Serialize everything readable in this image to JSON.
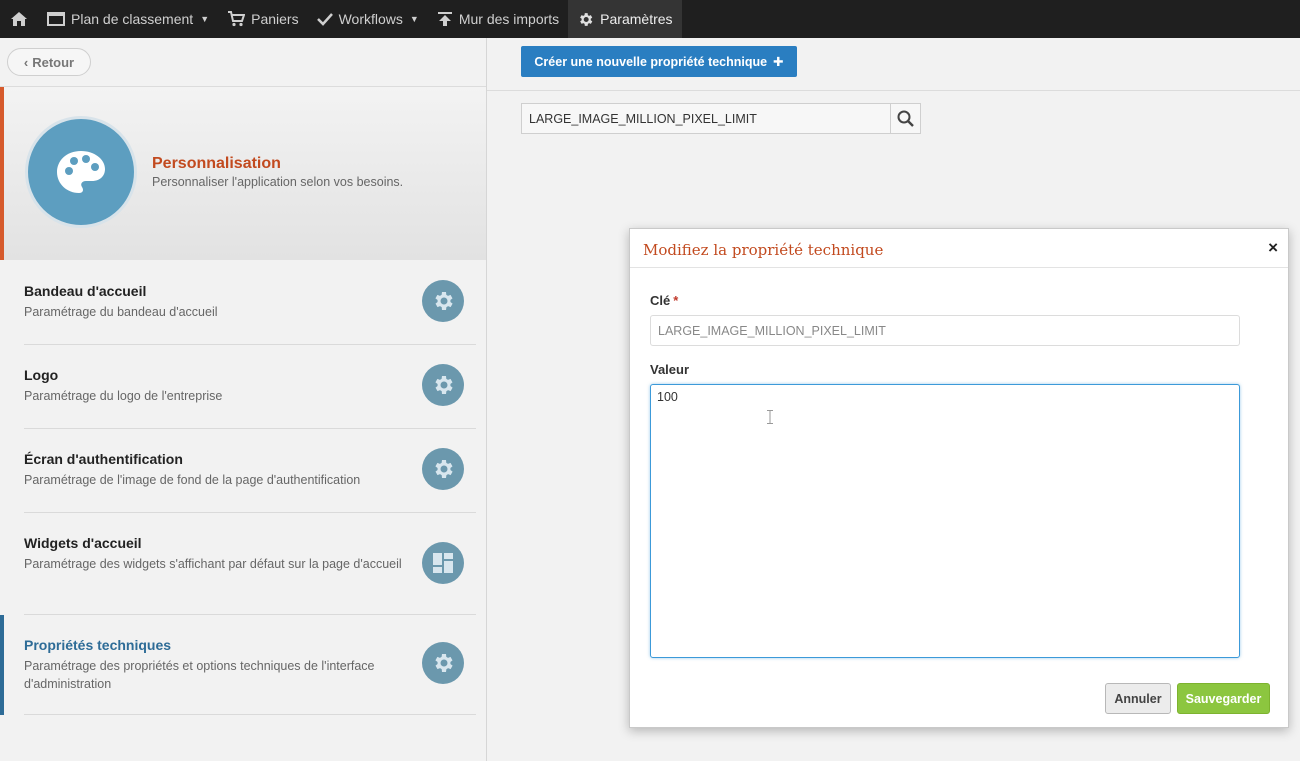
{
  "nav": {
    "items": [
      {
        "label": "Plan de classement",
        "icon": "folder-icon",
        "dropdown": true
      },
      {
        "label": "Paniers",
        "icon": "cart-icon",
        "dropdown": false
      },
      {
        "label": "Workflows",
        "icon": "check-icon",
        "dropdown": true
      },
      {
        "label": "Mur des imports",
        "icon": "upload-icon",
        "dropdown": false
      },
      {
        "label": "Paramètres",
        "icon": "gear-icon",
        "dropdown": false,
        "active": true
      }
    ]
  },
  "sidebar": {
    "back_label": "Retour",
    "hero": {
      "title": "Personnalisation",
      "subtitle": "Personnaliser l'application selon vos besoins."
    },
    "items": [
      {
        "title": "Bandeau d'accueil",
        "desc": "Paramétrage du bandeau d'accueil",
        "icon": "gear-icon"
      },
      {
        "title": "Logo",
        "desc": "Paramétrage du logo de l'entreprise",
        "icon": "gear-icon"
      },
      {
        "title": "Écran d'authentification",
        "desc": "Paramétrage de l'image de fond de la page d'authentification",
        "icon": "gear-icon"
      },
      {
        "title": "Widgets d'accueil",
        "desc": "Paramétrage des widgets s'affichant par défaut sur la page d'accueil",
        "icon": "dashboard-icon"
      },
      {
        "title": "Propriétés techniques",
        "desc": "Paramétrage des propriétés et options techniques de l'interface d'administration",
        "icon": "gear-icon",
        "active": true
      }
    ]
  },
  "main": {
    "create_label": "Créer une nouvelle propriété technique",
    "search_value": "LARGE_IMAGE_MILLION_PIXEL_LIMIT"
  },
  "modal": {
    "title": "Modifiez la propriété technique",
    "key_label": "Clé",
    "required_mark": "*",
    "key_value": "LARGE_IMAGE_MILLION_PIXEL_LIMIT",
    "value_label": "Valeur",
    "value_value": "100",
    "cancel_label": "Annuler",
    "save_label": "Sauvegarder"
  },
  "colors": {
    "accent_orange": "#c24a1f",
    "primary_blue": "#2a7ec1",
    "save_green": "#8cc63f",
    "nav_bg": "#1f1f1f"
  }
}
